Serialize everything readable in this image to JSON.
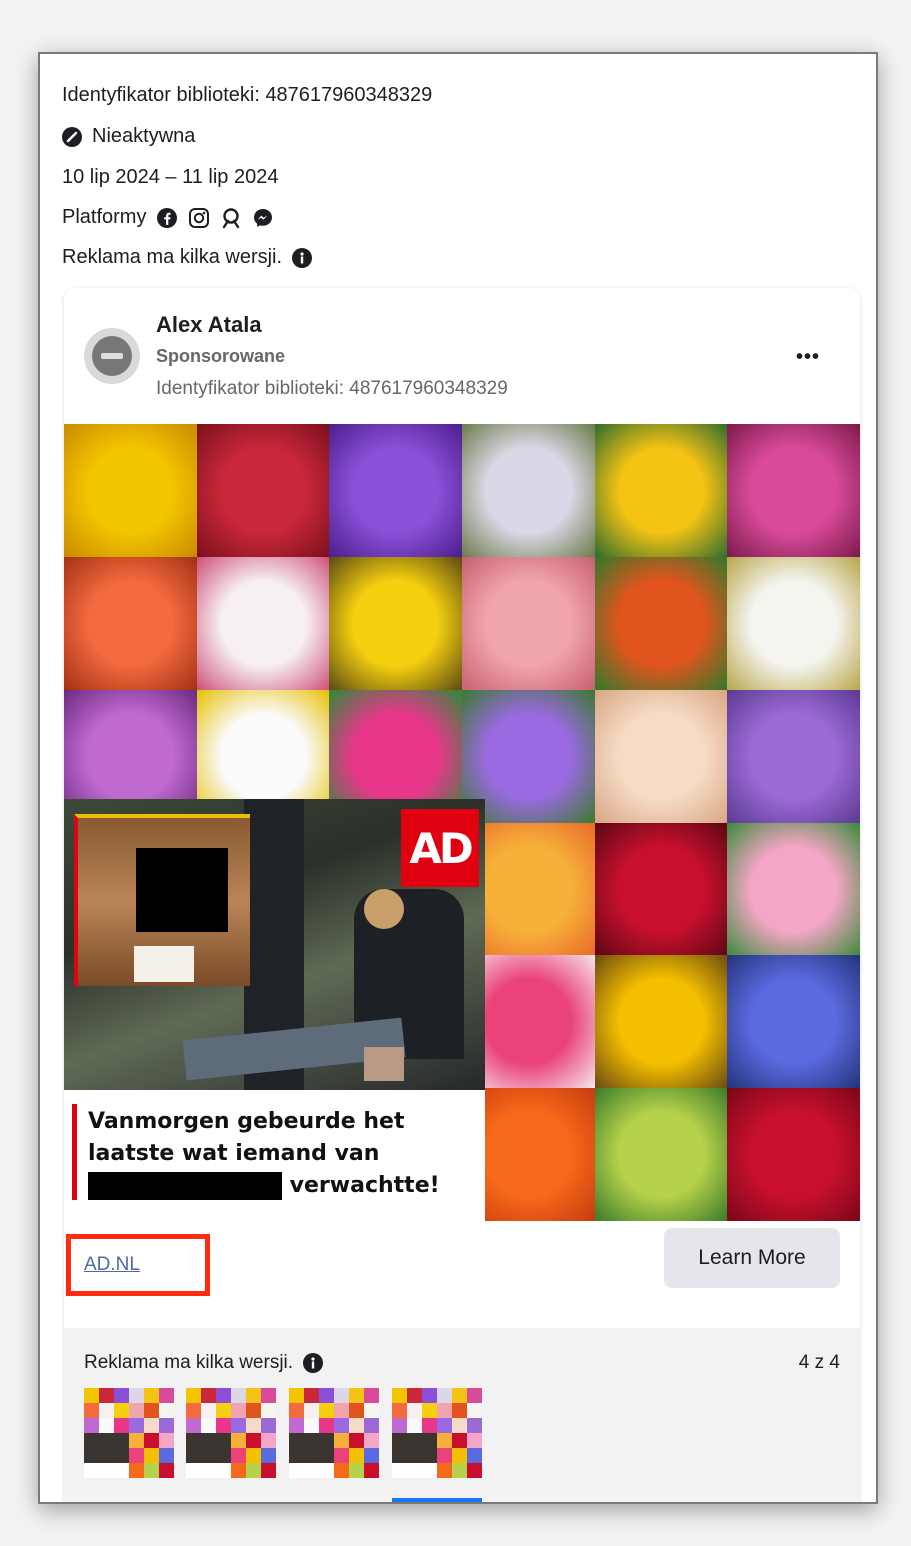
{
  "meta": {
    "library_id": "Identyfikator biblioteki: 487617960348329",
    "status": "Nieaktywna",
    "dates": "10 lip 2024 – 11 lip 2024",
    "platforms_label": "Platformy",
    "platforms": [
      "facebook-icon",
      "instagram-icon",
      "audience-network-icon",
      "messenger-icon"
    ],
    "versions_note": "Reklama ma kilka wersji."
  },
  "ad": {
    "page_name": "Alex Atala",
    "sponsored": "Sponsorowane",
    "library_id": "Identyfikator biblioteki: 487617960348329",
    "more": "•••",
    "logo_text": "AD",
    "headline_part1": "Vanmorgen gebeurde het laatste wat iemand van",
    "headline_part2": "verwachtte!",
    "link": "AD.NL",
    "cta": "Learn More"
  },
  "versions": {
    "label": "Reklama ma kilka wersji.",
    "count": "4 z 4",
    "selected_index": 4
  },
  "colors": {
    "accent": "#1877f2",
    "ad_red": "#e1000f",
    "highlight_red": "#ff2a10"
  }
}
